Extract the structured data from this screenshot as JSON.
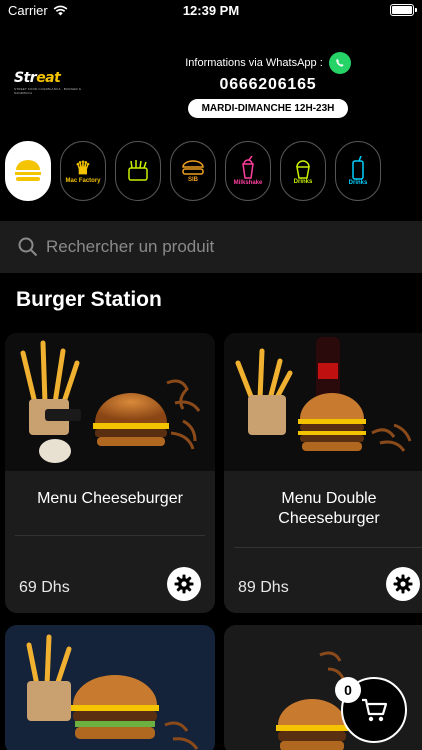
{
  "status_bar": {
    "carrier": "Carrier",
    "time": "12:39 PM"
  },
  "header": {
    "logo_text_a": "Str",
    "logo_text_b": "eat",
    "logo_tagline": "STREET FOOD CASABLANCA · BURGER & SANDWICH",
    "whatsapp_label": "Informations via WhatsApp :",
    "phone": "0666206165",
    "hours": "MARDI-DIMANCHE 12H-23H"
  },
  "categories": [
    {
      "label": "Burger Station",
      "color": "#f5c400"
    },
    {
      "label": "Mac Factory",
      "color": "#f5c400"
    },
    {
      "label": "Fries",
      "color": "#c8f000"
    },
    {
      "label": "SIB",
      "color": "#f0a020"
    },
    {
      "label": "Milkshake",
      "color": "#ff3fa0"
    },
    {
      "label": "Drinks",
      "color": "#c8f000"
    },
    {
      "label": "Drinks",
      "color": "#00d0ff"
    }
  ],
  "search": {
    "placeholder": "Rechercher un produit"
  },
  "section": {
    "title": "Burger Station"
  },
  "products": [
    {
      "name": "Menu Cheeseburger",
      "price": "69 Dhs"
    },
    {
      "name": "Menu Double Cheeseburger",
      "price": "89 Dhs"
    }
  ],
  "cart": {
    "count": "0"
  },
  "colors": {
    "accent": "#f5c400",
    "whatsapp": "#25d366",
    "card_bg": "#1c1c1c"
  }
}
